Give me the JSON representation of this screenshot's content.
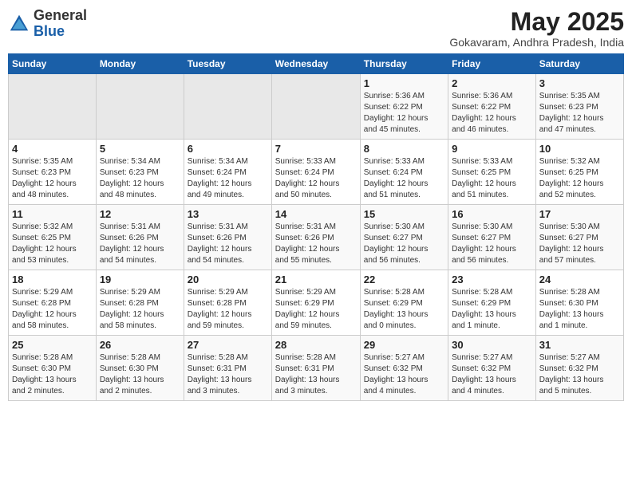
{
  "header": {
    "logo_general": "General",
    "logo_blue": "Blue",
    "title": "May 2025",
    "subtitle": "Gokavaram, Andhra Pradesh, India"
  },
  "days_of_week": [
    "Sunday",
    "Monday",
    "Tuesday",
    "Wednesday",
    "Thursday",
    "Friday",
    "Saturday"
  ],
  "weeks": [
    [
      {
        "day": "",
        "info": ""
      },
      {
        "day": "",
        "info": ""
      },
      {
        "day": "",
        "info": ""
      },
      {
        "day": "",
        "info": ""
      },
      {
        "day": "1",
        "info": "Sunrise: 5:36 AM\nSunset: 6:22 PM\nDaylight: 12 hours\nand 45 minutes."
      },
      {
        "day": "2",
        "info": "Sunrise: 5:36 AM\nSunset: 6:22 PM\nDaylight: 12 hours\nand 46 minutes."
      },
      {
        "day": "3",
        "info": "Sunrise: 5:35 AM\nSunset: 6:23 PM\nDaylight: 12 hours\nand 47 minutes."
      }
    ],
    [
      {
        "day": "4",
        "info": "Sunrise: 5:35 AM\nSunset: 6:23 PM\nDaylight: 12 hours\nand 48 minutes."
      },
      {
        "day": "5",
        "info": "Sunrise: 5:34 AM\nSunset: 6:23 PM\nDaylight: 12 hours\nand 48 minutes."
      },
      {
        "day": "6",
        "info": "Sunrise: 5:34 AM\nSunset: 6:24 PM\nDaylight: 12 hours\nand 49 minutes."
      },
      {
        "day": "7",
        "info": "Sunrise: 5:33 AM\nSunset: 6:24 PM\nDaylight: 12 hours\nand 50 minutes."
      },
      {
        "day": "8",
        "info": "Sunrise: 5:33 AM\nSunset: 6:24 PM\nDaylight: 12 hours\nand 51 minutes."
      },
      {
        "day": "9",
        "info": "Sunrise: 5:33 AM\nSunset: 6:25 PM\nDaylight: 12 hours\nand 51 minutes."
      },
      {
        "day": "10",
        "info": "Sunrise: 5:32 AM\nSunset: 6:25 PM\nDaylight: 12 hours\nand 52 minutes."
      }
    ],
    [
      {
        "day": "11",
        "info": "Sunrise: 5:32 AM\nSunset: 6:25 PM\nDaylight: 12 hours\nand 53 minutes."
      },
      {
        "day": "12",
        "info": "Sunrise: 5:31 AM\nSunset: 6:26 PM\nDaylight: 12 hours\nand 54 minutes."
      },
      {
        "day": "13",
        "info": "Sunrise: 5:31 AM\nSunset: 6:26 PM\nDaylight: 12 hours\nand 54 minutes."
      },
      {
        "day": "14",
        "info": "Sunrise: 5:31 AM\nSunset: 6:26 PM\nDaylight: 12 hours\nand 55 minutes."
      },
      {
        "day": "15",
        "info": "Sunrise: 5:30 AM\nSunset: 6:27 PM\nDaylight: 12 hours\nand 56 minutes."
      },
      {
        "day": "16",
        "info": "Sunrise: 5:30 AM\nSunset: 6:27 PM\nDaylight: 12 hours\nand 56 minutes."
      },
      {
        "day": "17",
        "info": "Sunrise: 5:30 AM\nSunset: 6:27 PM\nDaylight: 12 hours\nand 57 minutes."
      }
    ],
    [
      {
        "day": "18",
        "info": "Sunrise: 5:29 AM\nSunset: 6:28 PM\nDaylight: 12 hours\nand 58 minutes."
      },
      {
        "day": "19",
        "info": "Sunrise: 5:29 AM\nSunset: 6:28 PM\nDaylight: 12 hours\nand 58 minutes."
      },
      {
        "day": "20",
        "info": "Sunrise: 5:29 AM\nSunset: 6:28 PM\nDaylight: 12 hours\nand 59 minutes."
      },
      {
        "day": "21",
        "info": "Sunrise: 5:29 AM\nSunset: 6:29 PM\nDaylight: 12 hours\nand 59 minutes."
      },
      {
        "day": "22",
        "info": "Sunrise: 5:28 AM\nSunset: 6:29 PM\nDaylight: 13 hours\nand 0 minutes."
      },
      {
        "day": "23",
        "info": "Sunrise: 5:28 AM\nSunset: 6:29 PM\nDaylight: 13 hours\nand 1 minute."
      },
      {
        "day": "24",
        "info": "Sunrise: 5:28 AM\nSunset: 6:30 PM\nDaylight: 13 hours\nand 1 minute."
      }
    ],
    [
      {
        "day": "25",
        "info": "Sunrise: 5:28 AM\nSunset: 6:30 PM\nDaylight: 13 hours\nand 2 minutes."
      },
      {
        "day": "26",
        "info": "Sunrise: 5:28 AM\nSunset: 6:30 PM\nDaylight: 13 hours\nand 2 minutes."
      },
      {
        "day": "27",
        "info": "Sunrise: 5:28 AM\nSunset: 6:31 PM\nDaylight: 13 hours\nand 3 minutes."
      },
      {
        "day": "28",
        "info": "Sunrise: 5:28 AM\nSunset: 6:31 PM\nDaylight: 13 hours\nand 3 minutes."
      },
      {
        "day": "29",
        "info": "Sunrise: 5:27 AM\nSunset: 6:32 PM\nDaylight: 13 hours\nand 4 minutes."
      },
      {
        "day": "30",
        "info": "Sunrise: 5:27 AM\nSunset: 6:32 PM\nDaylight: 13 hours\nand 4 minutes."
      },
      {
        "day": "31",
        "info": "Sunrise: 5:27 AM\nSunset: 6:32 PM\nDaylight: 13 hours\nand 5 minutes."
      }
    ]
  ]
}
